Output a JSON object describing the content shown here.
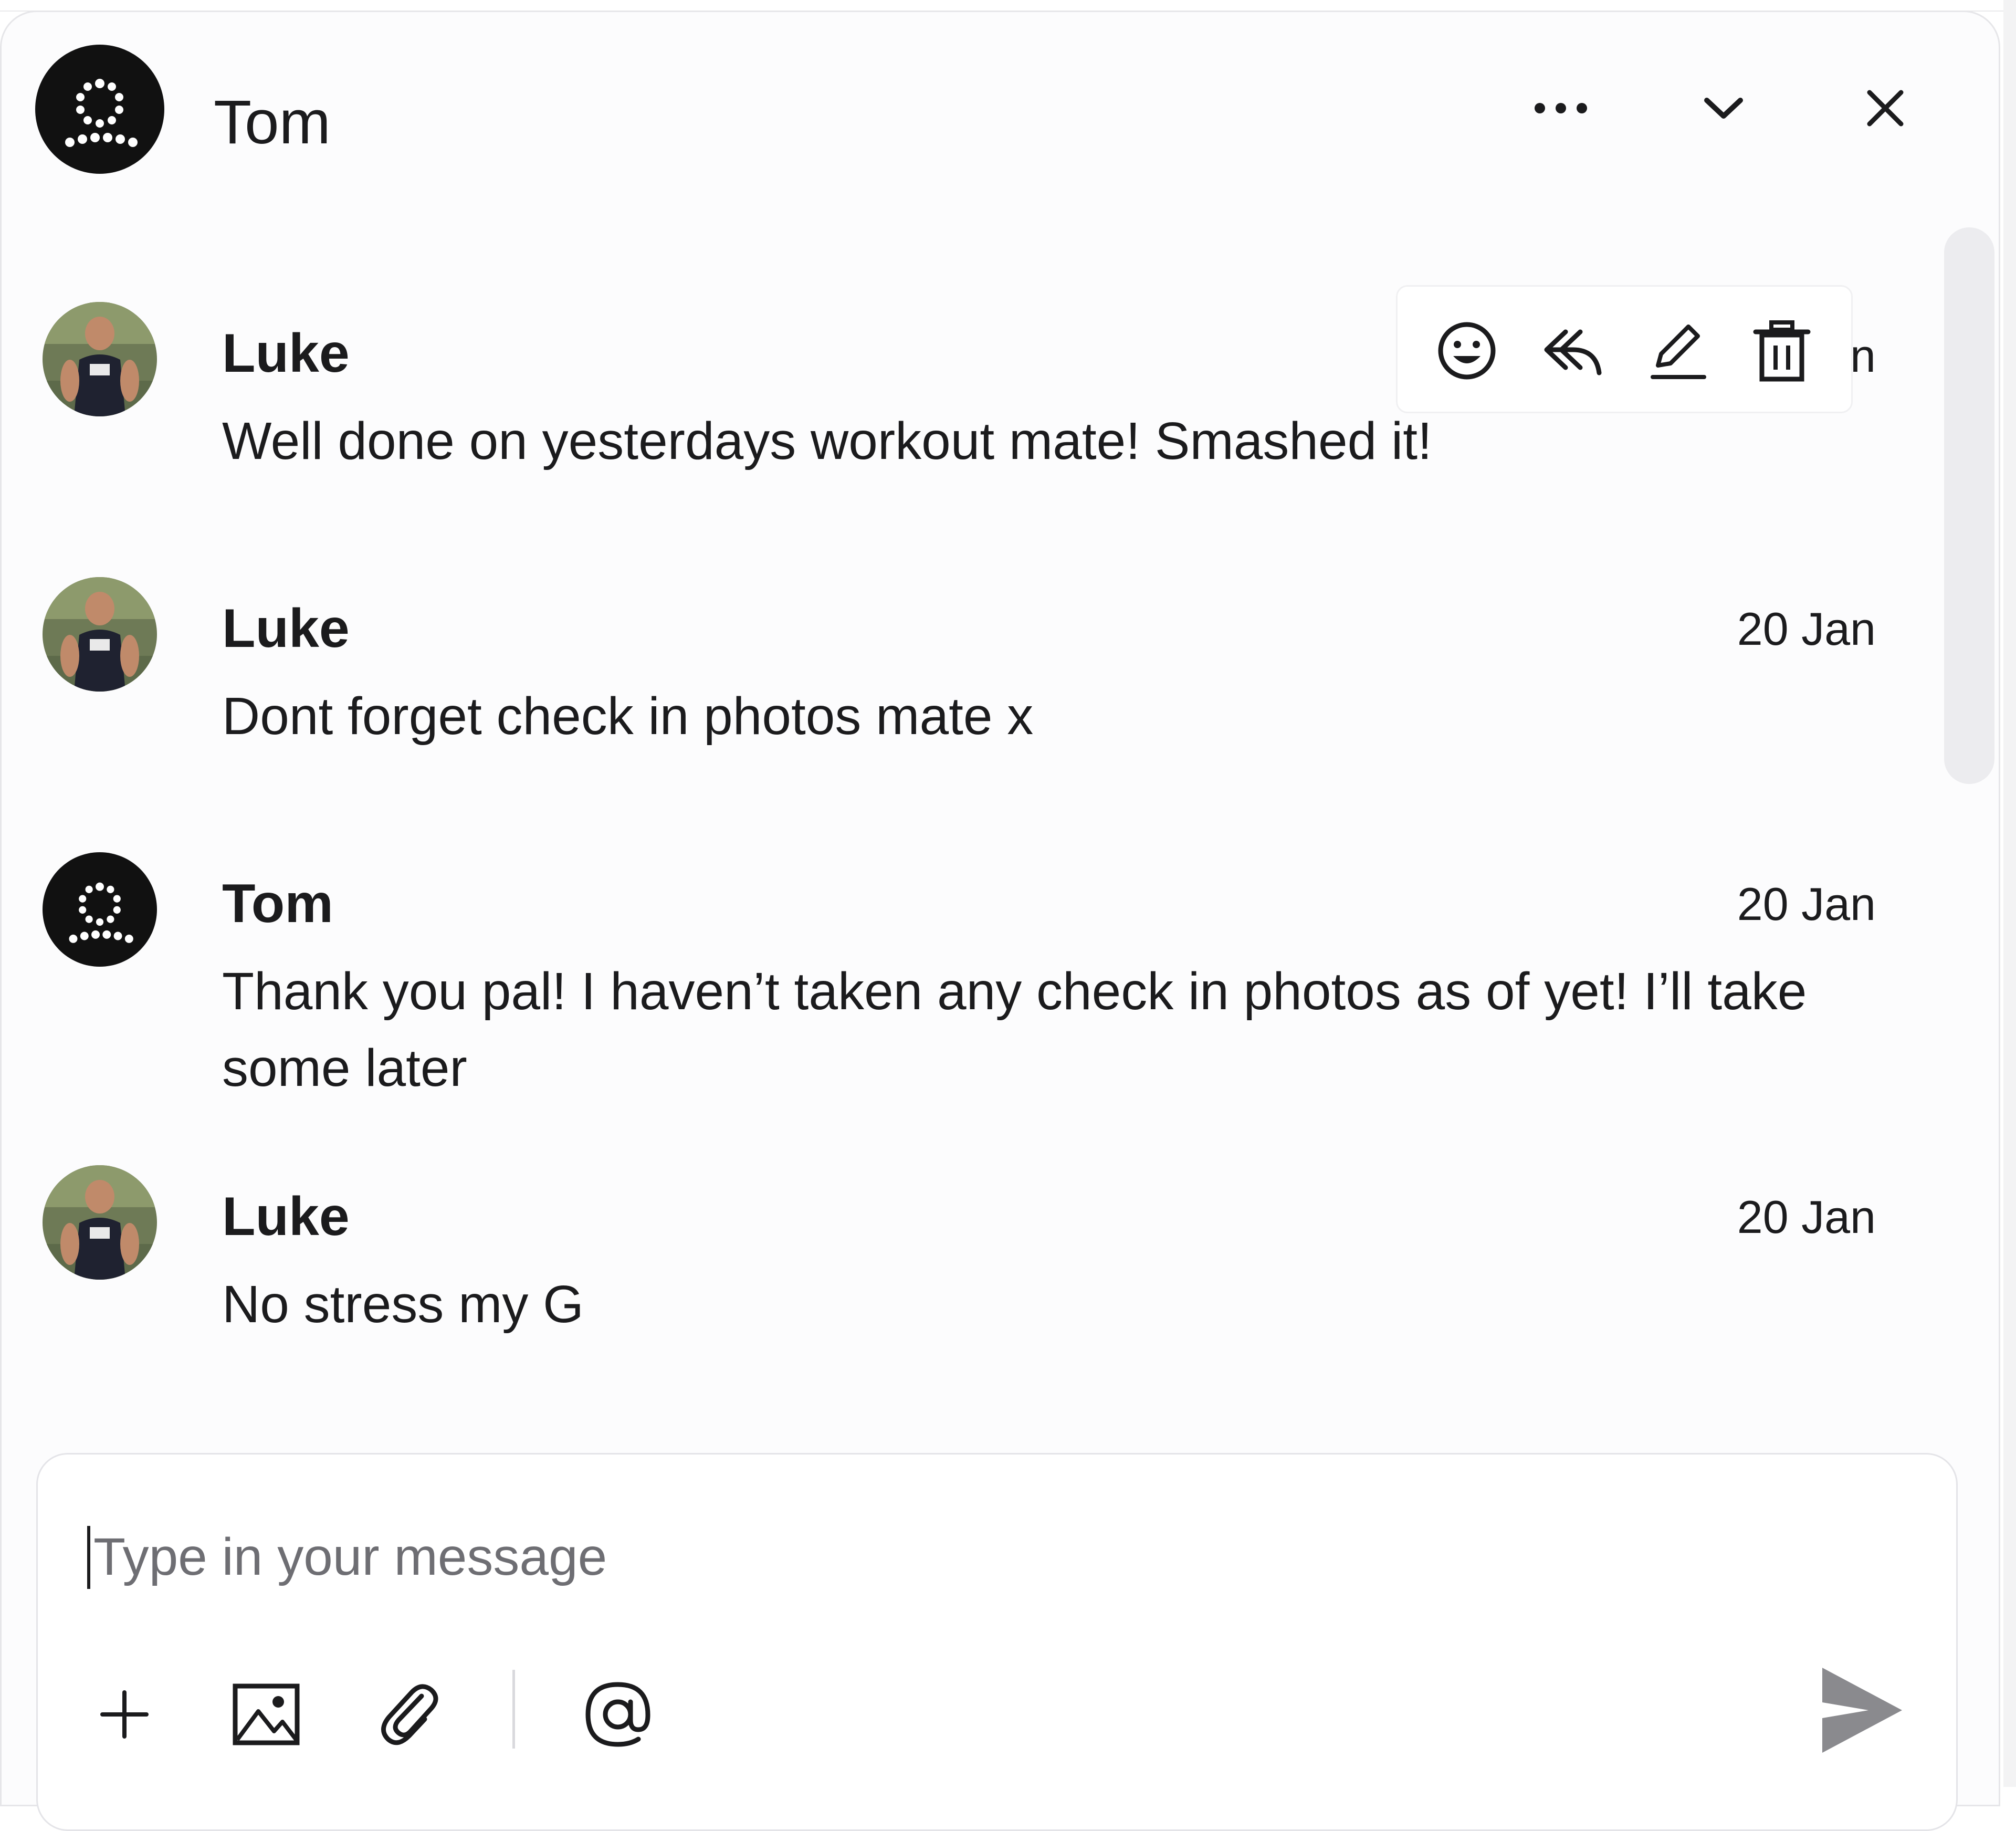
{
  "header": {
    "title": "Tom",
    "icons": {
      "avatar": "brand-logo-icon",
      "more": "more-horizontal-icon",
      "collapse": "chevron-down-icon",
      "close": "close-icon"
    }
  },
  "toolbar": {
    "icons": [
      "emoji-icon",
      "reply-icon",
      "edit-icon",
      "trash-icon"
    ]
  },
  "messages": [
    {
      "sender": "Luke",
      "time": "n",
      "text": "Well done on yesterdays workout mate! Smashed it!",
      "avatar": "user-photo"
    },
    {
      "sender": "Luke",
      "time": "20 Jan",
      "text": "Dont forget check in photos mate x",
      "avatar": "user-photo"
    },
    {
      "sender": "Tom",
      "time": "20 Jan",
      "text": "Thank you pal! I haven’t taken any check in photos as of yet! I’ll take some later",
      "avatar": "brand-logo-icon"
    },
    {
      "sender": "Luke",
      "time": "20 Jan",
      "text": "No stress my G",
      "avatar": "user-photo"
    }
  ],
  "composer": {
    "placeholder": "Type in your message",
    "value": "",
    "icons": [
      "plus-icon",
      "image-icon",
      "attachment-icon",
      "mention-icon",
      "send-icon"
    ]
  },
  "colors": {
    "text": "#1b1b1d",
    "panel_bg": "#fcfcfd",
    "border": "#e6e6e9",
    "send_disabled": "#8a8a8e",
    "avatar_dark": "#111111"
  }
}
